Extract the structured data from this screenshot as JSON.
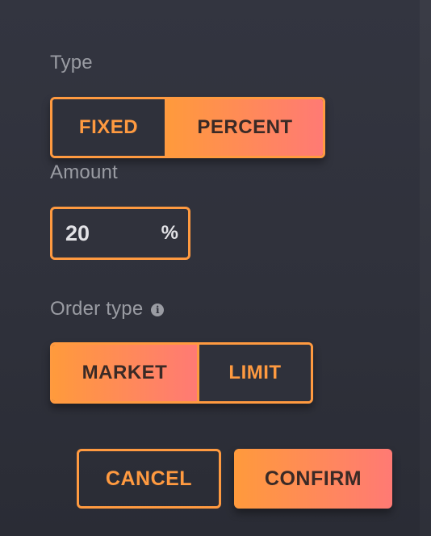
{
  "form": {
    "type_label": "Type",
    "type_options": {
      "fixed": "FIXED",
      "percent": "PERCENT"
    },
    "type_selected": "PERCENT",
    "amount_label": "Amount",
    "amount_value": "20",
    "amount_unit": "%",
    "order_type_label": "Order type",
    "order_type_options": {
      "market": "MARKET",
      "limit": "LIMIT"
    },
    "order_type_selected": "MARKET"
  },
  "actions": {
    "cancel_label": "CANCEL",
    "confirm_label": "CONFIRM"
  },
  "icons": {
    "info": "info-icon"
  },
  "colors": {
    "accent": "#ff9a40",
    "gradient_start": "#ff9a3c",
    "gradient_end": "#ff7a74",
    "background": "#2f313b",
    "label_text": "#9a9ca3",
    "value_text": "#e2e2e6"
  }
}
